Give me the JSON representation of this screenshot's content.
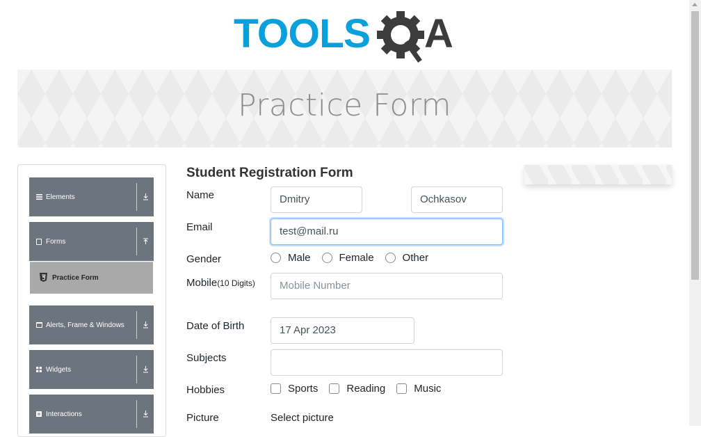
{
  "brand": {
    "logo_text_left": "TOOLS",
    "logo_text_right": "A"
  },
  "banner": {
    "title": "Practice Form"
  },
  "sidebar": {
    "groups": [
      {
        "label": "Elements",
        "icon": "list-icon",
        "state": "collapsed"
      },
      {
        "label": "Forms",
        "icon": "document-icon",
        "state": "expanded"
      },
      {
        "label": "Alerts, Frame & Windows",
        "icon": "window-icon",
        "state": "collapsed"
      },
      {
        "label": "Widgets",
        "icon": "grid-icon",
        "state": "collapsed"
      },
      {
        "label": "Interactions",
        "icon": "interaction-icon",
        "state": "collapsed"
      }
    ],
    "active_item": {
      "label": "Practice Form",
      "icon": "html5-icon"
    }
  },
  "form": {
    "title": "Student Registration Form",
    "name": {
      "label": "Name",
      "first_value": "Dmitry",
      "last_value": "Ochkasov"
    },
    "email": {
      "label": "Email",
      "value": "test@mail.ru"
    },
    "gender": {
      "label": "Gender",
      "options": [
        "Male",
        "Female",
        "Other"
      ]
    },
    "mobile": {
      "label": "Mobile",
      "label_suffix": "(10 Digits)",
      "placeholder": "Mobile Number"
    },
    "dob": {
      "label": "Date of Birth",
      "value": "17 Apr 2023"
    },
    "subjects": {
      "label": "Subjects",
      "value": ""
    },
    "hobbies": {
      "label": "Hobbies",
      "options": [
        "Sports",
        "Reading",
        "Music"
      ]
    },
    "picture": {
      "label": "Picture",
      "button_label": "Select picture"
    }
  },
  "colors": {
    "brand_blue": "#0aa0dc",
    "brand_dark": "#3c3c3c",
    "sidebar_group": "#6c757d",
    "active_item": "#a9a9a9",
    "focus_border": "#80bdff"
  }
}
